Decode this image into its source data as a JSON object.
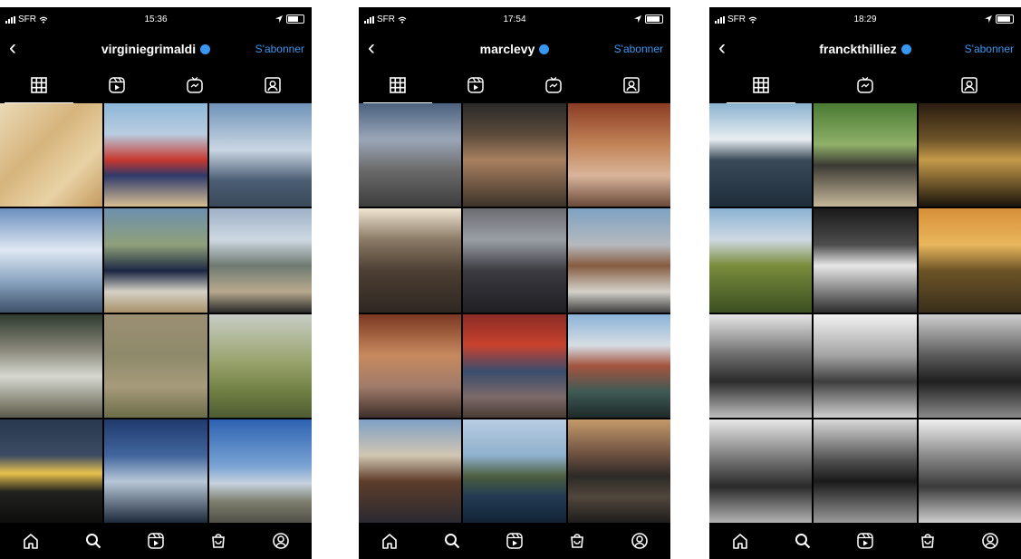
{
  "phones": [
    {
      "status": {
        "carrier": "SFR",
        "time": "15:36"
      },
      "header": {
        "username": "virginiegrimaldi",
        "follow_label": "S'abonner"
      },
      "tabs": [
        "grid-icon",
        "reels-icon",
        "igtv-icon",
        "tagged-icon"
      ],
      "thumbnails": [
        "linear-gradient(135deg,#e9d9b6 0%,#d6b47c 40%,#e8d2a5 70%,#c49a5e 100%)",
        "linear-gradient(180deg,#8db7d9 0%,#b9cde0 30%,#c7372f 55%,#2f3a6a 70%,#d7bf93 100%)",
        "linear-gradient(180deg,#6f93b8 0%,#c9d6e3 45%,#4b5d74 75%,#3a4a5a 100%)",
        "linear-gradient(180deg,#6b8fbf 0%,#dfe8f2 40%,#8aa4c1 70%,#3d5168 100%)",
        "linear-gradient(180deg,#6c8fae 0%,#8fa07a 35%,#1c2742 60%,#d5d1c6 80%,#a79169 100%)",
        "linear-gradient(180deg,#9fb1c8 0%,#cdd8e2 30%,#6f7a72 55%,#b8a98e 80%,#2a2a2a 100%)",
        "linear-gradient(180deg,#2e3a2e 0%,#8b8a7d 35%,#d6d8d0 60%,#5c5a48 100%)",
        "linear-gradient(180deg,#9c8f73 0%,#8e8a6a 40%,#a79b7b 70%,#6b6c48 100%)",
        "linear-gradient(180deg,#c7cdc6 0%,#9aa46e 45%,#6f7f42 75%,#4f5b33 100%)",
        "linear-gradient(180deg,#27384f 0%,#3d4c63 35%,#e8c24c 52%,#22231f 70%,#0d0e0d 100%)",
        "linear-gradient(180deg,#203a6d 0%,#41669e 35%,#b8c7d7 60%,#1c2a3b 100%)",
        "linear-gradient(180deg,#2c62b2 0%,#7aa3d4 45%,#c6d2de 62%,#7c7c6c 80%,#504f48 100%)"
      ]
    },
    {
      "status": {
        "carrier": "SFR",
        "time": "17:54"
      },
      "header": {
        "username": "marclevy",
        "follow_label": "S'abonner"
      },
      "tabs": [
        "grid-icon",
        "reels-icon",
        "igtv-icon",
        "tagged-icon"
      ],
      "thumbnails": [
        "linear-gradient(180deg,#4b617e 0%,#9aa6b7 35%,#6b6a6a 65%,#3d3d3d 100%)",
        "linear-gradient(180deg,#2a2a2a 0%,#5a4a3a 30%,#a88060 55%,#3d3329 100%)",
        "linear-gradient(180deg,#8a3c24 0%,#c28358 40%,#d9b49a 70%,#6a4a3a 100%)",
        "linear-gradient(180deg,#f0e6d2 0%,#8a7a66 30%,#4d3f33 60%,#2e2722 100%)",
        "linear-gradient(180deg,#6b6c72 0%,#9a9fa6 30%,#3b3a41 60%,#1f1f24 100%)",
        "linear-gradient(180deg,#7da2c2 0%,#b6b9be 35%,#865c41 55%,#d3d0c9 80%,#3e3e3e 100%)",
        "linear-gradient(180deg,#7b3822 0%,#c78a5e 40%,#9f7b6b 70%,#3e302b 100%)",
        "linear-gradient(180deg,#8a2c26 0%,#c9422e 30%,#3a4c6d 55%,#7c6a6a 80%,#4a3c34 100%)",
        "linear-gradient(180deg,#8bb3d9 0%,#d6dde3 30%,#a3543f 50%,#3f5a55 75%,#1e2a28 100%)",
        "linear-gradient(180deg,#7fa0c4 0%,#d1c6b2 35%,#5e3d2a 60%,#2a2a32 100%)",
        "linear-gradient(180deg,#b8cde3 0%,#8fb0cc 35%,#4c5e40 55%,#223b53 75%,#142436 100%)",
        "linear-gradient(180deg,#c49a6a 0%,#6a4e3f 35%,#2c2a27 55%,#51473c 75%,#1e1d1b 100%)"
      ]
    },
    {
      "status": {
        "carrier": "SFR",
        "time": "18:29"
      },
      "header": {
        "username": "franckthilliez",
        "follow_label": "S'abonner"
      },
      "tabs": [
        "grid-icon",
        "igtv-icon",
        "tagged-icon"
      ],
      "thumbnails": [
        "linear-gradient(180deg,#8ab2cf 0%,#e9eef1 35%,#3a4a58 55%,#1f2d3b 100%)",
        "linear-gradient(180deg,#4a7a33 0%,#8fb069 40%,#3c3a34 60%,#c6b79a 100%)",
        "linear-gradient(180deg,#2a1c10 0%,#6d5329 35%,#c49a4a 55%,#1a140c 100%)",
        "linear-gradient(180deg,#8bb2d3 0%,#cfd9e3 30%,#7a8c3c 55%,#3b4f22 100%)",
        "linear-gradient(180deg,#1a1a1a 0%,#4d4d4d 35%,#e7e7e7 55%,#2c2c2c 100%)",
        "linear-gradient(180deg,#d8903a 0%,#e9b65c 35%,#6b5326 60%,#3a2f1c 100%)",
        "linear-gradient(180deg,#e6e6e6 0%,#6a6a6a 40%,#2c2c2c 65%,#bdbdbd 100%)",
        "linear-gradient(180deg,#f2f2f2 0%,#a3a3a3 40%,#3e3e3e 65%,#d0d0d0 100%)",
        "linear-gradient(180deg,#cfcfcf 0%,#5a5a5a 40%,#1f1f1f 65%,#8a8a8a 100%)",
        "linear-gradient(180deg,#e8e8e8 0%,#707070 40%,#2a2a2a 65%,#b3b3b3 100%)",
        "linear-gradient(180deg,#d9d9d9 0%,#4e4e4e 40%,#1a1a1a 60%,#9a9a9a 100%)",
        "linear-gradient(180deg,#f0f0f0 0%,#8a8a8a 35%,#3a3a3a 65%,#cfcfcf 100%)"
      ]
    }
  ],
  "bottom_nav": [
    "home-icon",
    "search-icon",
    "reels-icon",
    "shop-icon",
    "profile-icon"
  ],
  "colors": {
    "background": "#000000",
    "accent": "#3897f0",
    "text": "#ffffff"
  }
}
